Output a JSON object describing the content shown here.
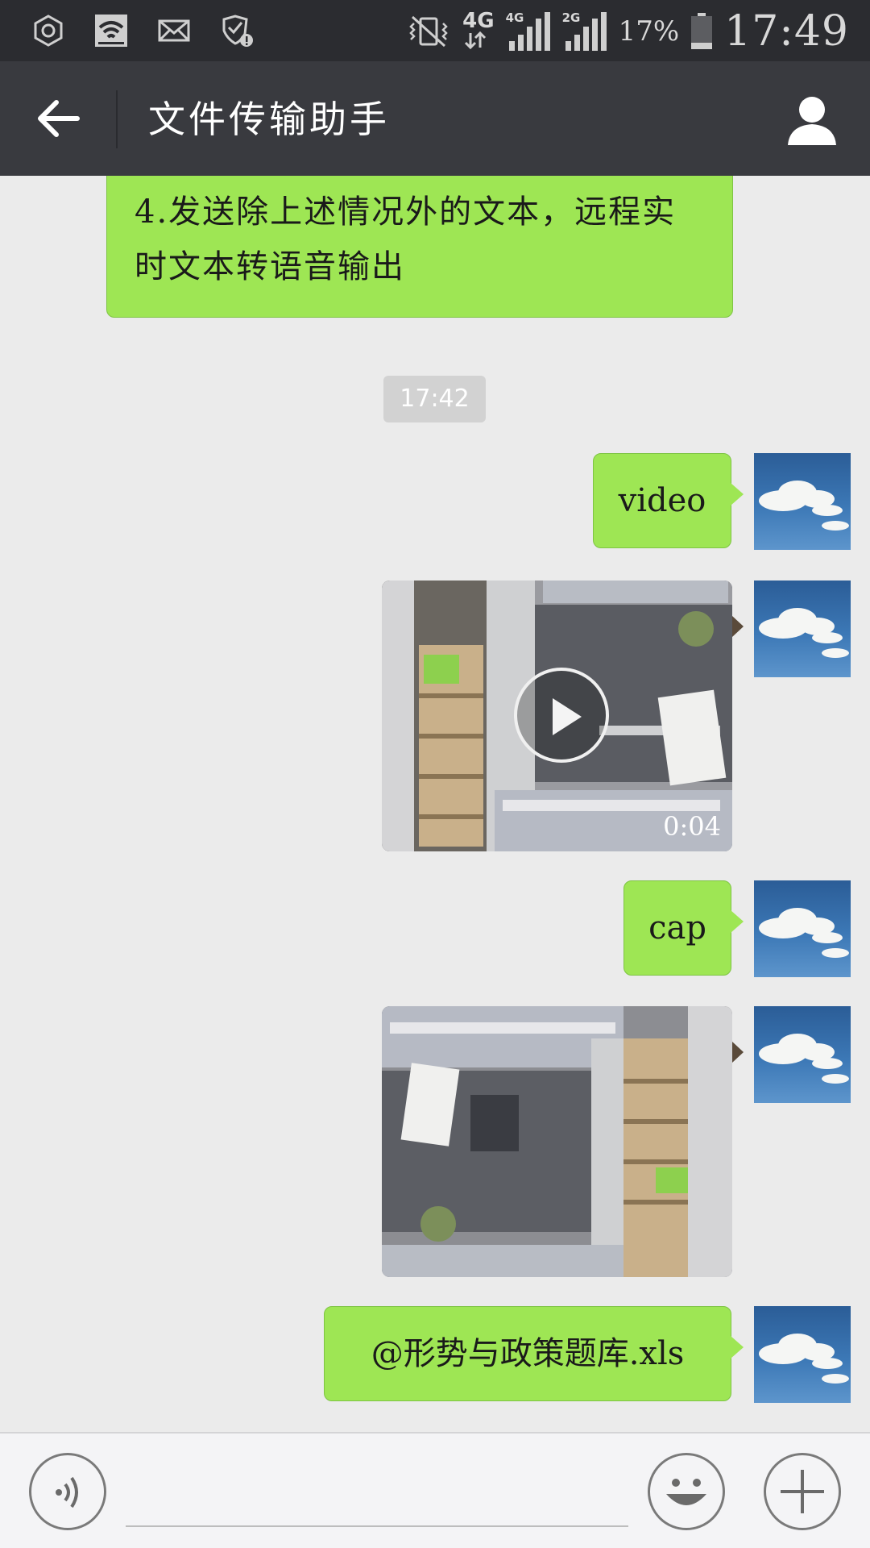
{
  "status_bar": {
    "network_4g": "4G",
    "signal_4g": "4G",
    "signal_2g": "2G",
    "battery": "17%",
    "time": "17:49",
    "icons": [
      "hexagon-icon",
      "wifi-icon",
      "mail-icon",
      "shield-alert-icon",
      "vibrate-mute-icon",
      "signal-4g-icon",
      "signal-2g-icon",
      "battery-icon"
    ]
  },
  "header": {
    "title": "文件传输助手",
    "back_icon": "arrow-left-icon",
    "profile_icon": "person-icon"
  },
  "messages": {
    "first_text_line1": "4.发送除上述情况外的文本，远程实",
    "first_text_line2": "时文本转语音输出",
    "timestamp": "17:42",
    "video_label": "video",
    "video_duration": "0:04",
    "cap_label": "cap",
    "file_label": "@形势与政策题库.xls"
  },
  "input": {
    "value": "",
    "voice_icon": "voice-icon",
    "emoji_icon": "emoji-icon",
    "plus_icon": "plus-icon"
  },
  "colors": {
    "bubble": "#9ee654",
    "header_bg": "#393a3f",
    "status_bg": "#2b2c30",
    "chat_bg": "#ebebeb"
  }
}
